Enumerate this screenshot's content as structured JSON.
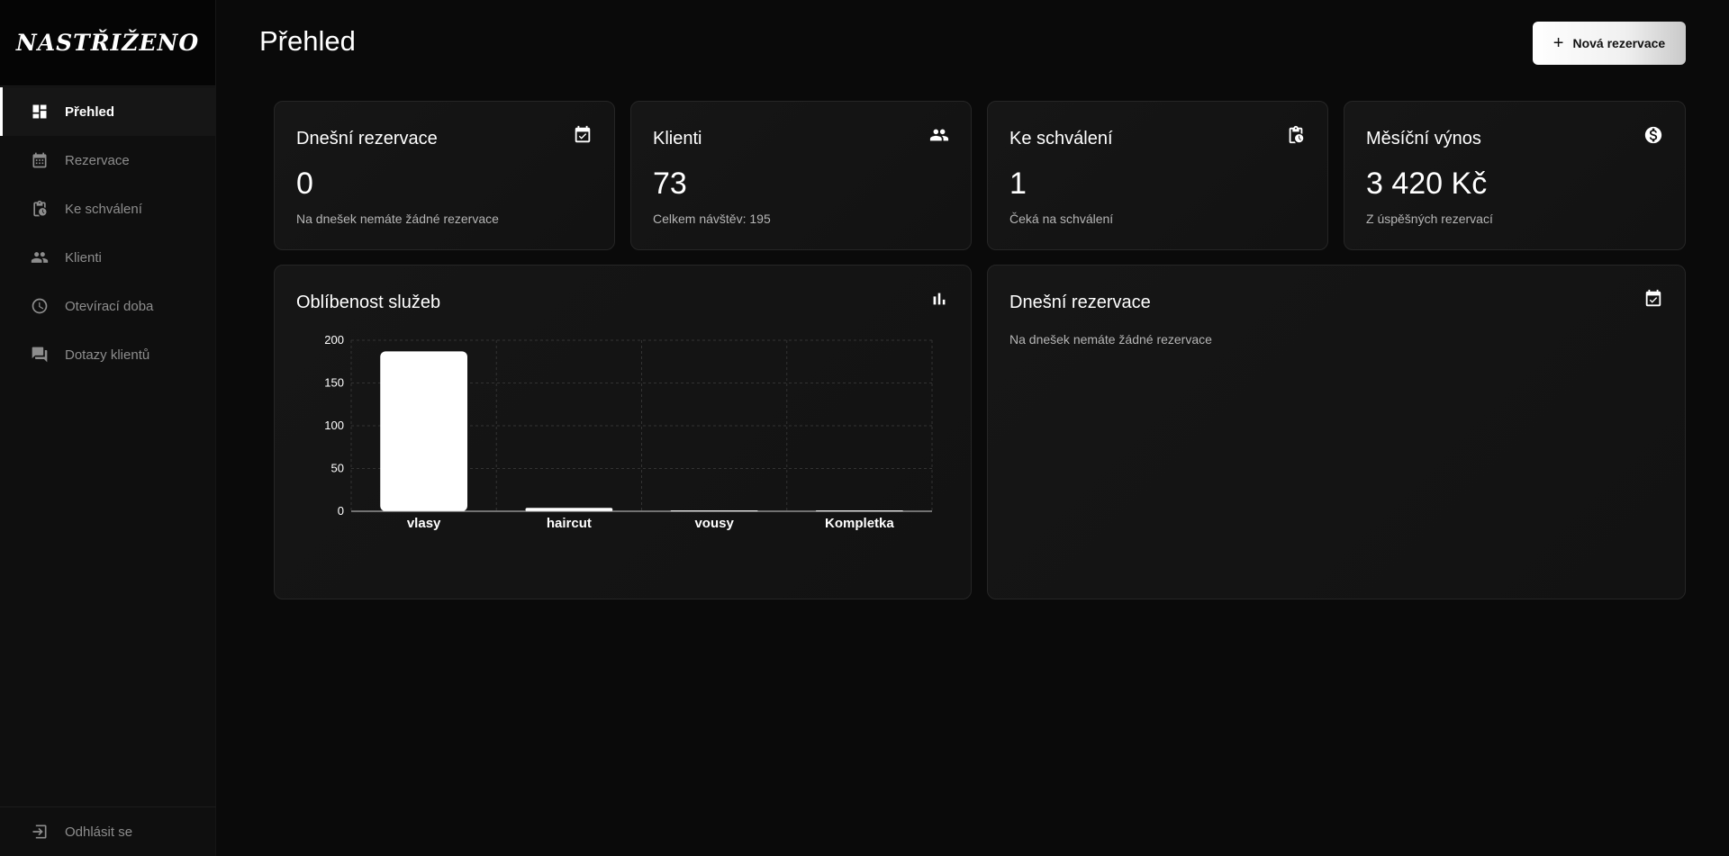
{
  "app": {
    "logo_text": "NASTŘIŽENO"
  },
  "sidebar": {
    "items": [
      {
        "label": "Přehled",
        "icon": "dashboard-icon",
        "active": true
      },
      {
        "label": "Rezervace",
        "icon": "calendar-icon",
        "active": false
      },
      {
        "label": "Ke schválení",
        "icon": "clipboard-clock-icon",
        "active": false
      },
      {
        "label": "Klienti",
        "icon": "people-icon",
        "active": false
      },
      {
        "label": "Otevírací doba",
        "icon": "clock-icon",
        "active": false
      },
      {
        "label": "Dotazy klientů",
        "icon": "chat-icon",
        "active": false
      }
    ],
    "logout_label": "Odhlásit se"
  },
  "header": {
    "title": "Přehled",
    "new_button_label": "Nová rezervace"
  },
  "stats": [
    {
      "title": "Dnešní rezervace",
      "value": "0",
      "sub": "Na dnešek nemáte žádné rezervace",
      "icon": "calendar-check-icon"
    },
    {
      "title": "Klienti",
      "value": "73",
      "sub": "Celkem návštěv: 195",
      "icon": "people-icon"
    },
    {
      "title": "Ke schválení",
      "value": "1",
      "sub": "Čeká na schválení",
      "icon": "clipboard-clock-icon"
    },
    {
      "title": "Měsíční výnos",
      "value": "3 420 Kč",
      "sub": "Z úspěšných rezervací",
      "icon": "dollar-circle-icon"
    }
  ],
  "services_panel": {
    "title": "Oblíbenost služeb",
    "icon": "bar-chart-icon"
  },
  "today_panel": {
    "title": "Dnešní rezervace",
    "empty_text": "Na dnešek nemáte žádné rezervace",
    "icon": "calendar-check-icon"
  },
  "colors": {
    "background": "#0a0a0a",
    "card": "#151515",
    "accent": "#ffffff",
    "muted": "#8d8d8d"
  },
  "chart_data": {
    "type": "bar",
    "categories": [
      "vlasy",
      "haircut",
      "vousy",
      "Kompletka"
    ],
    "values": [
      187,
      4,
      1,
      1
    ],
    "ylim": [
      0,
      200
    ],
    "yticks": [
      0,
      50,
      100,
      150,
      200
    ],
    "grid": true,
    "title": "Oblíbenost služeb",
    "xlabel": "",
    "ylabel": ""
  }
}
